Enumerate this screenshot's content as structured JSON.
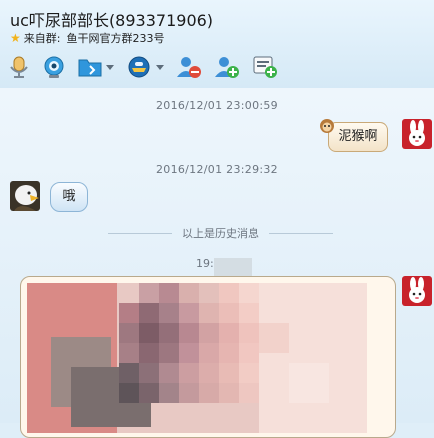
{
  "header": {
    "title": "uc吓尿部部长(893371906)",
    "from_group_label": "来自群:",
    "from_group_name": "鱼干网官方群233号"
  },
  "toolbar": {
    "icons": [
      "microphone-icon",
      "webcam-icon",
      "folder-icon",
      "remote-assist-icon",
      "remove-member-icon",
      "add-member-icon",
      "message-add-icon"
    ]
  },
  "messages": {
    "ts1": "2016/12/01 23:00:59",
    "msg1": "泥猴啊",
    "ts2": "2016/12/01 23:29:32",
    "msg2": "哦",
    "history_divider": "以上是历史消息",
    "ts3_partial": "19:0"
  },
  "colors": {
    "header_bg": "#e9f5fd",
    "chat_bg": "#e3f0f9",
    "bubble_left_border": "#8db5d6",
    "bubble_right_border": "#c9a978"
  }
}
